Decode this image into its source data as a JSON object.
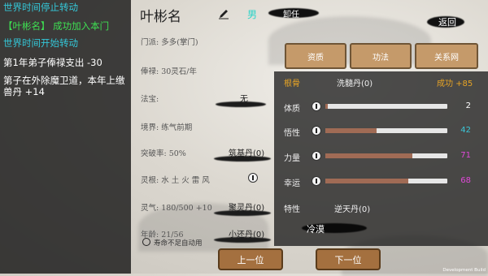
{
  "log": {
    "lines": [
      {
        "text": "世界时间停止转动",
        "color": "#34c7d8"
      },
      {
        "text": "【叶彬名】 成功加入本门",
        "color": "#3ee052"
      },
      {
        "text": "世界时间开始转动",
        "color": "#34c7d8"
      },
      {
        "text": "第1年弟子俸禄支出 -30",
        "color": "#ffffff"
      },
      {
        "text": "第子在外除魔卫道，本年上缴",
        "color": "#ffffff"
      },
      {
        "text": "兽丹 +14",
        "color": "#ffffff"
      }
    ]
  },
  "character": {
    "name": "叶彬名",
    "gender": "男",
    "resign_label": "卸任",
    "back_label": "返回",
    "sect": "门派: 多多(掌门)",
    "salary": "俸禄: 30灵石/年",
    "treasure_label": "法宝:",
    "treasure_value": "无",
    "realm": "境界: 练气前期",
    "breakthrough_rate": "突破率: 50%",
    "breakthrough_item": "筑基丹(0)",
    "spirit_root": "灵根: 水 土 火 雷 风",
    "spirit_qi": "灵气: 180/500 +10",
    "spirit_item": "聚灵丹(0)",
    "age": "年龄: 21/56",
    "age_item": "小还丹(0)",
    "auto_use_label": "寿命不足自动用"
  },
  "tabs": [
    "资质",
    "功法",
    "关系网"
  ],
  "stats_panel": {
    "header_left": "根骨",
    "header_item": "洗髓丹(0)",
    "header_right": "成功 +85",
    "stats": [
      {
        "label": "体质",
        "value": 2,
        "max": 100,
        "color": "#ffffff"
      },
      {
        "label": "悟性",
        "value": 42,
        "max": 100,
        "color": "#3bc7d8"
      },
      {
        "label": "力量",
        "value": 71,
        "max": 100,
        "color": "#e048d8"
      },
      {
        "label": "幸运",
        "value": 68,
        "max": 100,
        "color": "#e048d8"
      }
    ],
    "trait_label": "特性",
    "trait_item": "逆天丹(0)",
    "trait_value": "冷漠"
  },
  "nav": {
    "prev_label": "上一位",
    "next_label": "下一位"
  },
  "footer": "Development Build"
}
